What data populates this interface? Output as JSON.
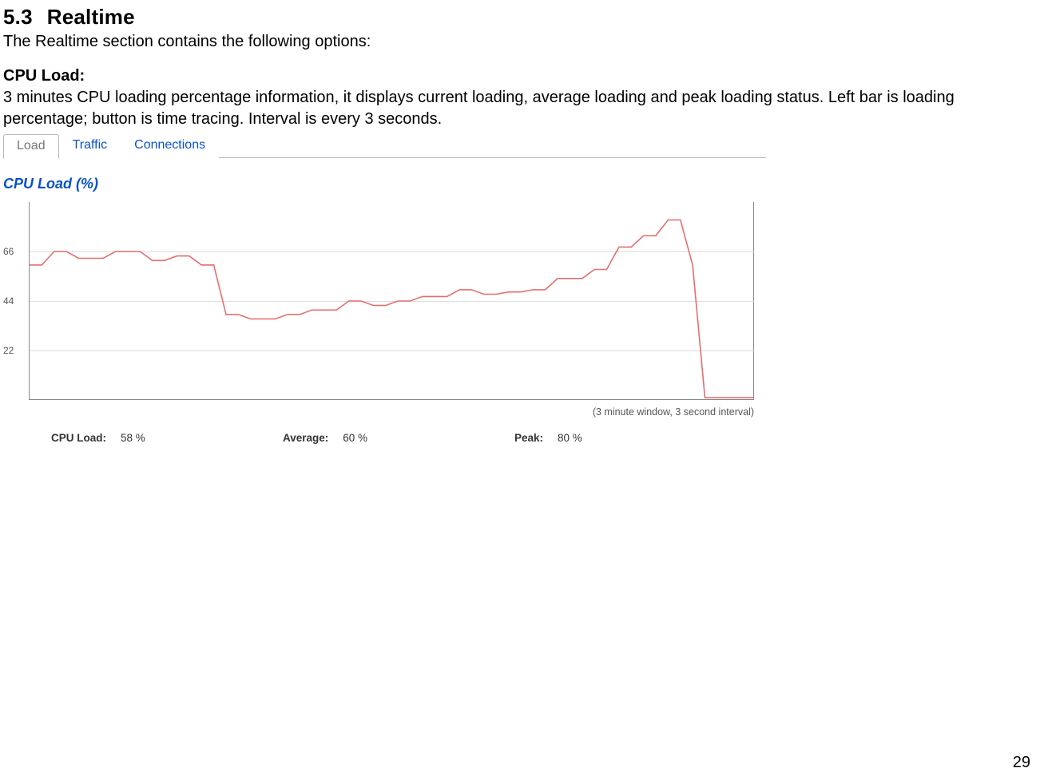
{
  "heading": {
    "num": "5.3",
    "title": "Realtime"
  },
  "intro": "The Realtime section contains the following options:",
  "cpu_block": {
    "label": "CPU Load:",
    "desc": "3 minutes CPU loading percentage information, it displays current loading, average loading and peak loading status. Left bar is loading percentage; button is time tracing. Interval is every 3 seconds."
  },
  "tabs": {
    "items": [
      "Load",
      "Traffic",
      "Connections"
    ],
    "active_index": 0
  },
  "chart_title": "CPU Load (%)",
  "chart_caption": "(3 minute window, 3 second interval)",
  "y_ticks": [
    "66",
    "44",
    "22"
  ],
  "stats": {
    "load_key": "CPU Load:",
    "load_val": "58 %",
    "avg_key": "Average:",
    "avg_val": "60 %",
    "peak_key": "Peak:",
    "peak_val": "80 %"
  },
  "page_number": "29",
  "chart_data": {
    "type": "line",
    "title": "CPU Load (%)",
    "xlabel": "",
    "ylabel": "CPU Load (%)",
    "ylim": [
      0,
      88
    ],
    "x_count": 60,
    "series": [
      {
        "name": "CPU Load",
        "values": [
          60,
          60,
          66,
          66,
          63,
          63,
          63,
          66,
          66,
          66,
          62,
          62,
          64,
          64,
          60,
          60,
          38,
          38,
          36,
          36,
          36,
          38,
          38,
          40,
          40,
          40,
          44,
          44,
          42,
          42,
          44,
          44,
          46,
          46,
          46,
          49,
          49,
          47,
          47,
          48,
          48,
          49,
          49,
          54,
          54,
          54,
          58,
          58,
          68,
          68,
          73,
          73,
          80,
          80,
          60,
          1,
          1,
          1,
          1,
          1
        ]
      }
    ],
    "annotations": [
      "(3 minute window, 3 second interval)"
    ]
  }
}
